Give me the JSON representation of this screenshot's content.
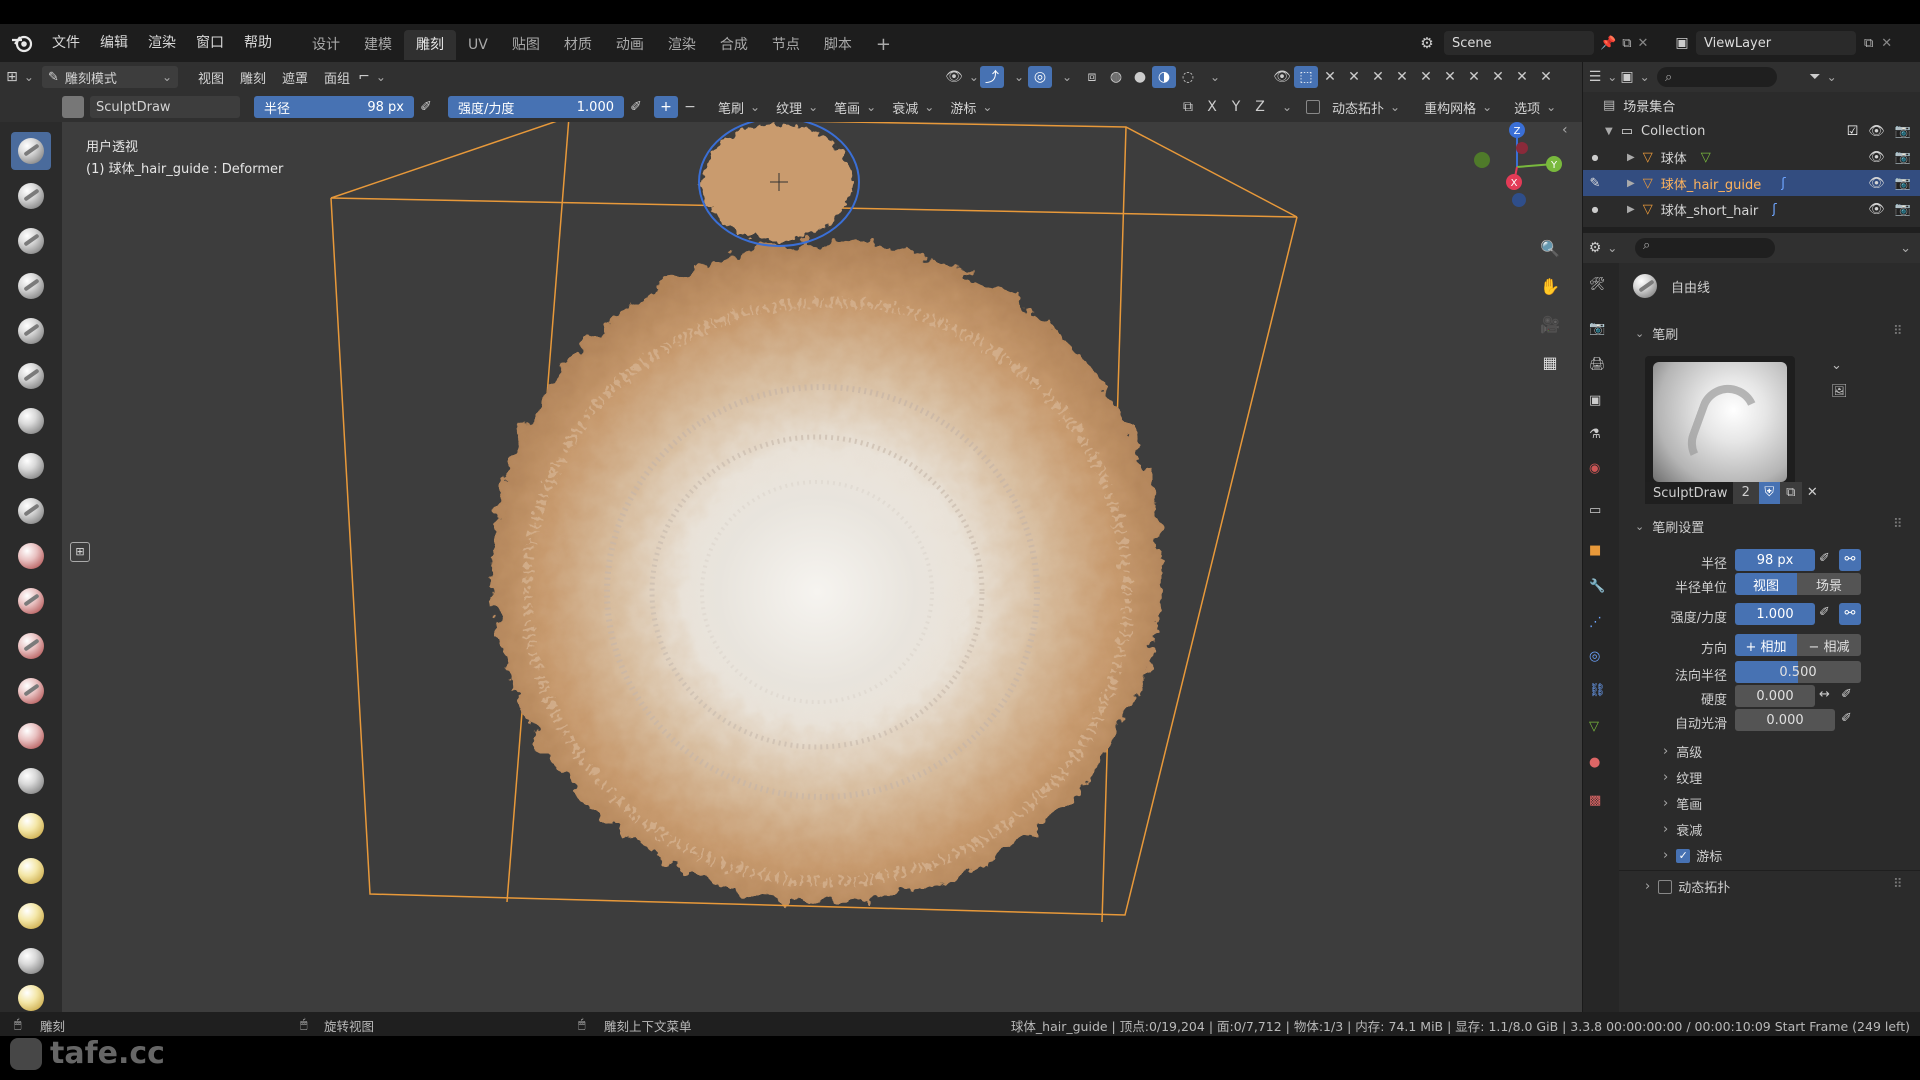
{
  "menu": {
    "items": [
      "文件",
      "编辑",
      "渲染",
      "窗口",
      "帮助"
    ],
    "workspaces": [
      "设计",
      "建模",
      "雕刻",
      "UV",
      "贴图",
      "材质",
      "动画",
      "渲染",
      "合成",
      "节点",
      "脚本"
    ],
    "active_workspace": "雕刻",
    "add_tab": "+",
    "scene_name": "Scene",
    "viewlayer_name": "ViewLayer"
  },
  "header": {
    "mode": "雕刻模式",
    "menus": [
      "视图",
      "雕刻",
      "遮罩",
      "面组"
    ],
    "brush_name": "SculptDraw",
    "radius_label": "半径",
    "radius_value": "98 px",
    "strength_label": "强度/力度",
    "strength_value": "1.000",
    "dropdowns": [
      "笔刷",
      "纹理",
      "笔画",
      "衰减",
      "游标"
    ],
    "axes": [
      "X",
      "Y",
      "Z"
    ],
    "dyntopo": "动态拓扑",
    "remesh": "重构网格",
    "options": "选项"
  },
  "viewport": {
    "view_name": "用户透视",
    "object_info": "(1) 球体_hair_guide : Deformer",
    "colors": {
      "bg": "#3d3d3d",
      "bbox": "#e8993a",
      "brush_circle": "#3a6fd6",
      "fur": "#c79a6e"
    }
  },
  "outliner": {
    "root": "场景集合",
    "collection": "Collection",
    "objects": [
      {
        "name": "球体",
        "selected": false
      },
      {
        "name": "球体_hair_guide",
        "selected": true
      },
      {
        "name": "球体_short_hair",
        "selected": false
      }
    ]
  },
  "properties": {
    "tool_name": "自由线",
    "brush_section": "笔刷",
    "brush_datablock": "SculptDraw",
    "brush_users": "2",
    "settings_section": "笔刷设置",
    "fields": {
      "radius_label": "半径",
      "radius_value": "98 px",
      "radius_unit_label": "半径单位",
      "unit_view": "视图",
      "unit_scene": "场景",
      "strength_label": "强度/力度",
      "strength_value": "1.000",
      "direction_label": "方向",
      "dir_add": "+  相加",
      "dir_sub": "−  相减",
      "normal_radius_label": "法向半径",
      "normal_radius_value": "0.500",
      "hardness_label": "硬度",
      "hardness_value": "0.000",
      "autosmooth_label": "自动光滑",
      "autosmooth_value": "0.000"
    },
    "normal_radius_fraction": 0.5,
    "subsections": [
      "高级",
      "纹理",
      "笔画",
      "衰减",
      "游标"
    ],
    "cursor_checked": true,
    "dyntopo_section": "动态拓扑"
  },
  "statusbar": {
    "left": "雕刻",
    "rotate": "旋转视图",
    "context": "雕刻上下文菜单",
    "stats": "球体_hair_guide | 顶点:0/19,204 | 面:0/7,712 | 物体:1/3 | 内存: 74.1 MiB | 显存: 1.1/8.0 GiB | 3.3.8  00:00:00:00 / 00:00:10:09  Start Frame (249 left)"
  },
  "watermark": "tafe.cc"
}
